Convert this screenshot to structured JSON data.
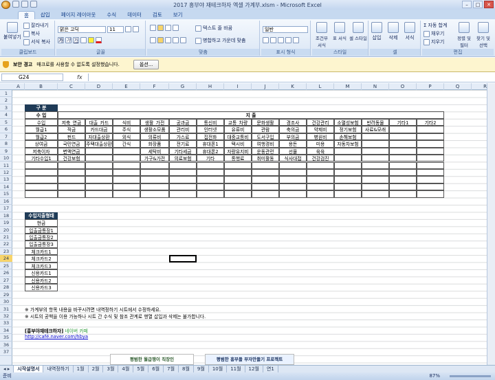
{
  "window": {
    "title": "2017 흥부야 재테크하자 엑셀 가계부.xlsm - Microsoft Excel"
  },
  "tabs": [
    "홈",
    "삽입",
    "페이지 레이아웃",
    "수식",
    "데이터",
    "검토",
    "보기"
  ],
  "ribbon": {
    "clipboard": {
      "paste": "붙여넣기",
      "cut": "잘라내기",
      "copy": "복사",
      "format_painter": "서식 복사",
      "label": "클립보드"
    },
    "font": {
      "name": "맑은 고딕",
      "size": "11",
      "label": "글꼴"
    },
    "alignment": {
      "wrap": "텍스트 줄 바꿈",
      "merge": "병합하고 가운데 맞춤",
      "label": "맞춤"
    },
    "number": {
      "format": "일반",
      "label": "표시 형식"
    },
    "styles": {
      "cond": "조건부 서식",
      "table": "표 서식",
      "cell": "셀 스타일",
      "label": "스타일"
    },
    "cells": {
      "insert": "삽입",
      "delete": "삭제",
      "format": "서식",
      "label": "셀"
    },
    "editing": {
      "autosum": "자동 합계",
      "fill": "채우기",
      "clear": "지우기",
      "sort": "정렬 및 필터",
      "find": "찾기 및 선택",
      "label": "편집"
    }
  },
  "security": {
    "title": "보안 경고",
    "message": "매크로를 사용할 수 없도록 설정했습니다.",
    "options": "옵션..."
  },
  "formula_bar": {
    "name_box": "G24",
    "fx": "fx",
    "formula": ""
  },
  "columns": [
    "A",
    "B",
    "C",
    "D",
    "E",
    "F",
    "G",
    "H",
    "I",
    "J",
    "K",
    "L",
    "M",
    "N",
    "O",
    "P",
    "Q",
    "R"
  ],
  "rows": [
    "1",
    "2",
    "3",
    "4",
    "5",
    "6",
    "7",
    "8",
    "9",
    "10",
    "11",
    "12",
    "13",
    "14",
    "15",
    "16",
    "17",
    "18",
    "19",
    "20",
    "21",
    "22",
    "23",
    "24",
    "25",
    "26",
    "27",
    "28",
    "29",
    "30",
    "31",
    "32",
    "33",
    "34",
    "35",
    "36",
    "37"
  ],
  "sheet": {
    "section_header": "구 분",
    "income_header": "수 입",
    "expense_header": "지 출",
    "income_col": "수입",
    "expense_cols": [
      "저축_연금",
      "대출_카드",
      "식비",
      "생활_가전",
      "공과금",
      "통신비",
      "교통_차량",
      "문화생활",
      "경조사",
      "건강관리",
      "소멸성보험",
      "반려동물",
      "기타1",
      "기타2"
    ],
    "rows": [
      [
        "월급1",
        "적금",
        "카드대금",
        "주식",
        "생활소모품",
        "관리비",
        "인터넷",
        "유류비",
        "관람",
        "축의금",
        "약제비",
        "정기보험",
        "사료&모래",
        "",
        ""
      ],
      [
        "월급2",
        "펀드",
        "자대출상환",
        "외식",
        "의류비",
        "가스료",
        "집전화",
        "대중교통비",
        "도서구입",
        "부의금",
        "병원비",
        "손해보험",
        "",
        "",
        ""
      ],
      [
        "상여금",
        "국민연금",
        "주택대출상환",
        "간식",
        "화장품",
        "전기료",
        "휴대폰1",
        "택시비",
        "여행경비",
        "용돈",
        "미용",
        "자동차보험",
        "",
        "",
        ""
      ],
      [
        "저축이자",
        "변액연금",
        "",
        "",
        "세탁비",
        "기타세금",
        "휴대폰2",
        "자량유지비",
        "운동관련",
        "선물",
        "육육",
        "",
        "",
        "",
        ""
      ],
      [
        "기타수입1",
        "건강보험",
        "",
        "",
        "가구&가전",
        "의료보험",
        "기타",
        "통행료",
        "취미활동",
        "식사대접",
        "건강검진",
        "",
        "",
        "",
        ""
      ]
    ],
    "payment_header": "수입지출형태",
    "payment_types": [
      "현금",
      "입출금통장1",
      "입출금통장2",
      "입출금통장3",
      "체크카드1",
      "체크카드2",
      "체크카드3",
      "신용카드1",
      "신용카드2",
      "신용카드3"
    ],
    "note1": "※ 가계부의 항목 내용을 바꾸시려면 내역정하기 시트에서 수정하세요.",
    "note2": "※ 시트의 공백을 이용 가능하나 시트 간 수식 및 참조 관계로 행열 삽입과 삭제는 불가합니다.",
    "cafe_title": "[흥부야재테크하자]",
    "cafe_brand": "네이버 카페",
    "cafe_url": "http://café.naver.com/hbya"
  },
  "ads": [
    "평범한 월급쟁이 직장인",
    "평범한 흥부들 부자만들기 프로젝트"
  ],
  "sheet_tabs": [
    "시작설명서",
    "내역정하기",
    "1월",
    "2월",
    "3월",
    "4월",
    "5월",
    "6월",
    "7월",
    "8월",
    "9월",
    "10월",
    "11월",
    "12월",
    "연1"
  ],
  "status": {
    "ready": "준비",
    "zoom": "87%"
  },
  "colors": {
    "dark_header": "#1f3b57",
    "accent_link": "#0000cc",
    "brand_green": "#2e9c3a"
  }
}
